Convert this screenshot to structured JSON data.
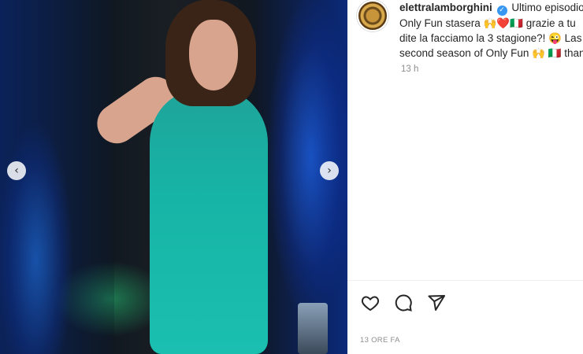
{
  "post": {
    "username": "elettralamborghini",
    "caption_line1": "Ultimo episodio",
    "caption_line2": "Only Fun stasera 🙌❤️🇮🇹 grazie a tu",
    "caption_line3": "dite la facciamo la 3 stagione?! 😜 Las",
    "caption_line4": "second season of Only Fun 🙌 🇮🇹 than",
    "relative_time": "13 h",
    "timestamp": "13 ORE FA"
  },
  "media": {
    "prev_label": "‹",
    "next_label": "›"
  },
  "icons": {
    "like": "heart-icon",
    "comment": "comment-icon",
    "share": "share-icon",
    "verified": "verified-badge-icon"
  },
  "colors": {
    "verified": "#3897f0",
    "dress": "#1bbfb0",
    "muted_text": "#8e8e8e"
  }
}
